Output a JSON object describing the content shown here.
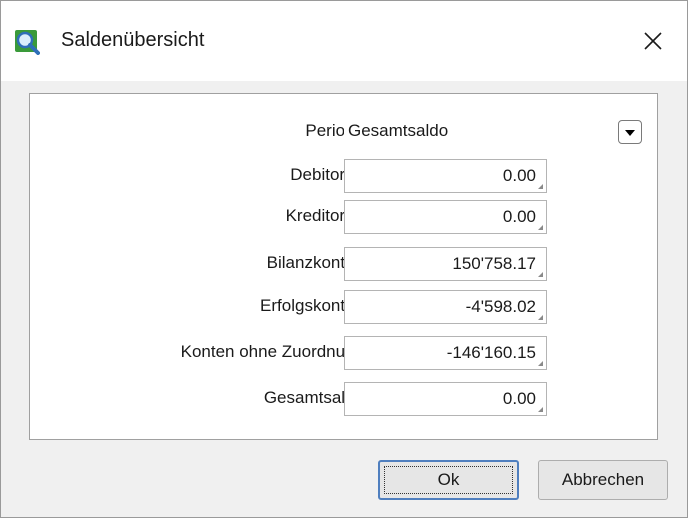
{
  "window": {
    "title": "Saldenübersicht",
    "icon": "magnifier-icon",
    "close_icon": "close-icon"
  },
  "form": {
    "periode": {
      "label": "Periode",
      "value": "Gesamtsaldo"
    },
    "fields": [
      {
        "label": "Debitoren",
        "value": "0.00"
      },
      {
        "label": "Kreditoren",
        "value": "0.00"
      },
      {
        "label": "Bilanzkonten",
        "value": "150'758.17"
      },
      {
        "label": "Erfolgskonten",
        "value": "-4'598.02"
      },
      {
        "label": "Konten ohne Zuordnung",
        "value": "-146'160.15"
      },
      {
        "label": "Gesamtsaldo",
        "value": "0.00"
      }
    ]
  },
  "buttons": {
    "ok": "Ok",
    "cancel": "Abbrechen"
  },
  "colors": {
    "focus_border": "#4f7fbf",
    "icon_green": "#3a9a3a",
    "icon_blue": "#2f6fb8"
  }
}
